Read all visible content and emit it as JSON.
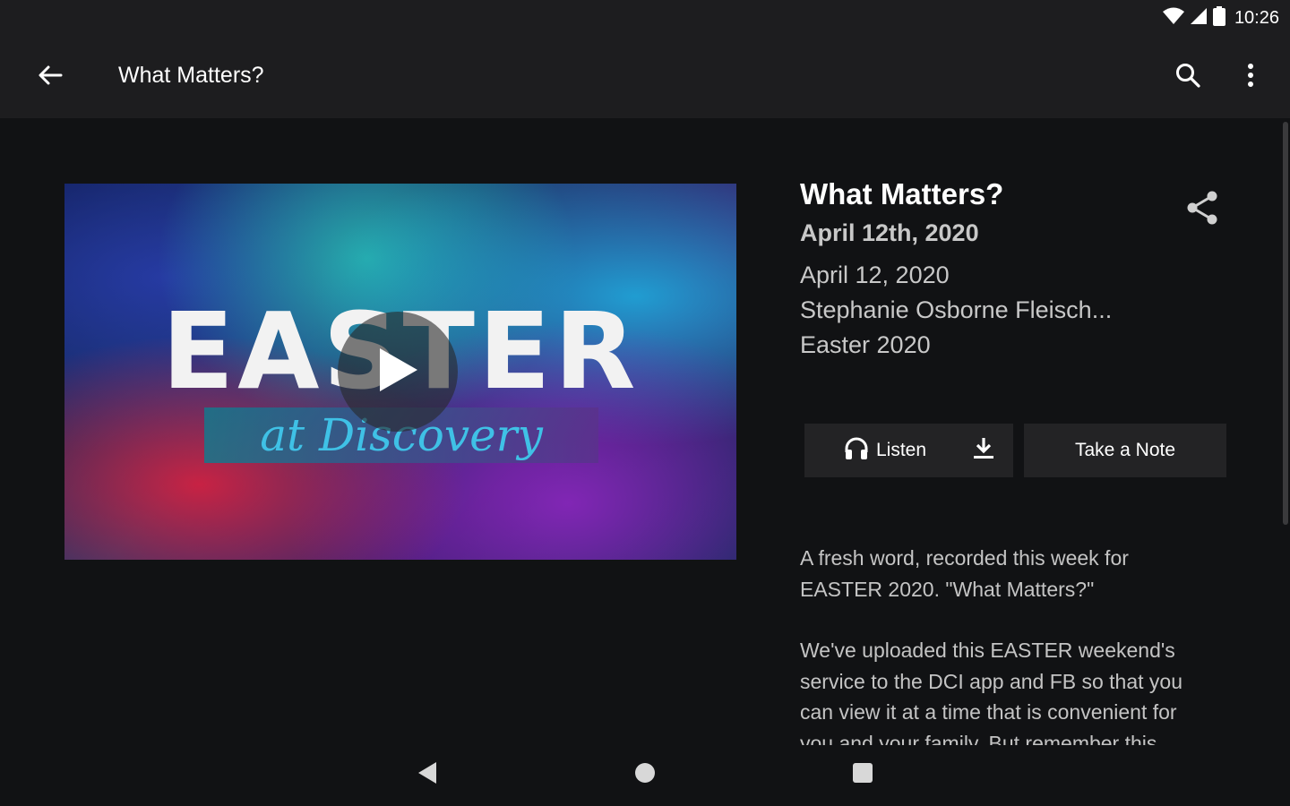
{
  "status_bar": {
    "time": "10:26",
    "icons": [
      "wifi-icon",
      "cell-signal-icon",
      "battery-icon"
    ]
  },
  "app_bar": {
    "title": "What Matters?",
    "back_icon": "arrow-back-icon",
    "search_icon": "search-icon",
    "more_icon": "more-vert-icon"
  },
  "media": {
    "thumbnail_title": "EASTER",
    "thumbnail_subtitle": "at Discovery",
    "play_icon": "play-icon"
  },
  "sermon": {
    "title": "What Matters?",
    "date_bold": "April 12th, 2020",
    "date": "April 12, 2020",
    "speaker": "Stephanie Osborne Fleisch...",
    "series": "Easter 2020",
    "share_icon": "share-icon"
  },
  "actions": {
    "listen_label": "Listen",
    "listen_icon": "headphones-icon",
    "download_icon": "download-icon",
    "note_label": "Take a Note"
  },
  "description": {
    "paragraphs": [
      "A fresh word, recorded this week for EASTER 2020. \"What Matters?\"",
      "We've uploaded this EASTER weekend's service to the DCI app and FB so that you can view it at a time that is convenient for you and your family. But remember this"
    ]
  },
  "nav_bar": {
    "icons": [
      "nav-back-icon",
      "nav-home-icon",
      "nav-recents-icon"
    ]
  },
  "colors": {
    "background": "#111214",
    "bar": "#1d1d1f",
    "button": "#232325",
    "text_secondary": "#c8c8c8"
  }
}
